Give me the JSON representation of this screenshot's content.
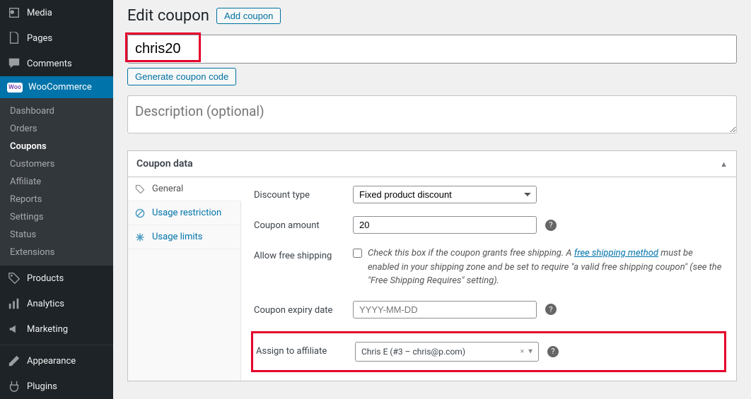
{
  "nav": {
    "media": "Media",
    "pages": "Pages",
    "comments": "Comments",
    "woocommerce": "WooCommerce",
    "sub": {
      "dashboard": "Dashboard",
      "orders": "Orders",
      "coupons": "Coupons",
      "customers": "Customers",
      "affiliate": "Affiliate",
      "reports": "Reports",
      "settings": "Settings",
      "status": "Status",
      "extensions": "Extensions"
    },
    "products": "Products",
    "analytics": "Analytics",
    "marketing": "Marketing",
    "appearance": "Appearance",
    "plugins": "Plugins"
  },
  "header": {
    "title": "Edit coupon",
    "add": "Add coupon"
  },
  "coupon": {
    "code": "chris20",
    "gen": "Generate coupon code",
    "desc_ph": "Description (optional)"
  },
  "panel": {
    "title": "Coupon data",
    "tabs": {
      "general": "General",
      "usage_restriction": "Usage restriction",
      "usage_limits": "Usage limits"
    },
    "rows": {
      "discount_type": {
        "label": "Discount type",
        "value": "Fixed product discount"
      },
      "amount": {
        "label": "Coupon amount",
        "value": "20"
      },
      "free_ship": {
        "label": "Allow free shipping",
        "desc1": "Check this box if the coupon grants free shipping. A ",
        "link": "free shipping method",
        "desc2": " must be enabled in your shipping zone and be set to require \"a valid free shipping coupon\" (see the \"Free Shipping Requires\" setting)."
      },
      "expiry": {
        "label": "Coupon expiry date",
        "ph": "YYYY-MM-DD"
      },
      "affiliate": {
        "label": "Assign to affiliate",
        "value": "Chris E (#3 – chris@p.com)"
      }
    }
  }
}
